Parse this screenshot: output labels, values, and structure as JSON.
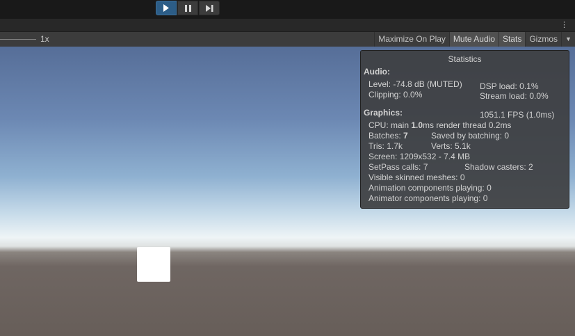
{
  "toolbar": {
    "scale_label": "1x",
    "buttons": [
      "Maximize On Play",
      "Mute Audio",
      "Stats",
      "Gizmos"
    ]
  },
  "stats": {
    "title": "Statistics",
    "audio_header": "Audio:",
    "audio_level": "Level: -74.8 dB (MUTED)",
    "audio_clipping": "Clipping: 0.0%",
    "dsp_load": "DSP load: 0.1%",
    "stream_load": "Stream load: 0.0%",
    "graphics_header": "Graphics:",
    "fps": "1051.1 FPS (1.0ms)",
    "cpu_prefix": "CPU: main ",
    "cpu_main": "1.0",
    "cpu_suffix": "ms  render thread 0.2ms",
    "batches_prefix": "Batches: ",
    "batches_value": "7",
    "saved_by_batching": "Saved by batching: 0",
    "tris": "Tris: 1.7k",
    "verts": "Verts: 5.1k",
    "screen": "Screen: 1209x532 - 7.4 MB",
    "setpass": "SetPass calls: 7",
    "shadow_casters": "Shadow casters: 2",
    "visible_skinned": "Visible skinned meshes: 0",
    "animation_components": "Animation components playing: 0",
    "animator_components": "Animator components playing: 0"
  }
}
